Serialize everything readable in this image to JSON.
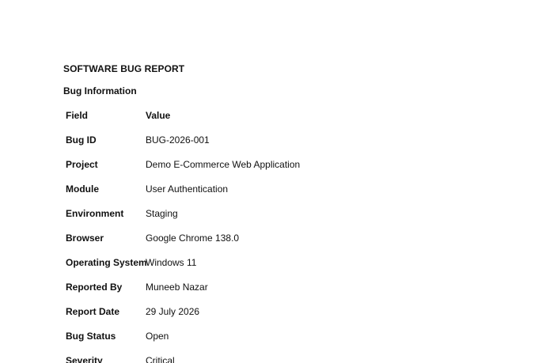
{
  "document": {
    "title": "SOFTWARE BUG REPORT",
    "section_heading": "Bug Information",
    "table": {
      "header": {
        "field": "Field",
        "value": "Value"
      },
      "rows": [
        {
          "field": "Bug ID",
          "value": "BUG-2026-001"
        },
        {
          "field": "Project",
          "value": "Demo E-Commerce Web Application"
        },
        {
          "field": "Module",
          "value": "User Authentication"
        },
        {
          "field": "Environment",
          "value": "Staging"
        },
        {
          "field": "Browser",
          "value": "Google Chrome 138.0"
        },
        {
          "field": "Operating System",
          "value": "Windows 11"
        },
        {
          "field": "Reported By",
          "value": "Muneeb Nazar"
        },
        {
          "field": "Report Date",
          "value": "29 July 2026"
        },
        {
          "field": "Bug Status",
          "value": "Open"
        },
        {
          "field": "Severity",
          "value": "Critical"
        }
      ]
    }
  }
}
